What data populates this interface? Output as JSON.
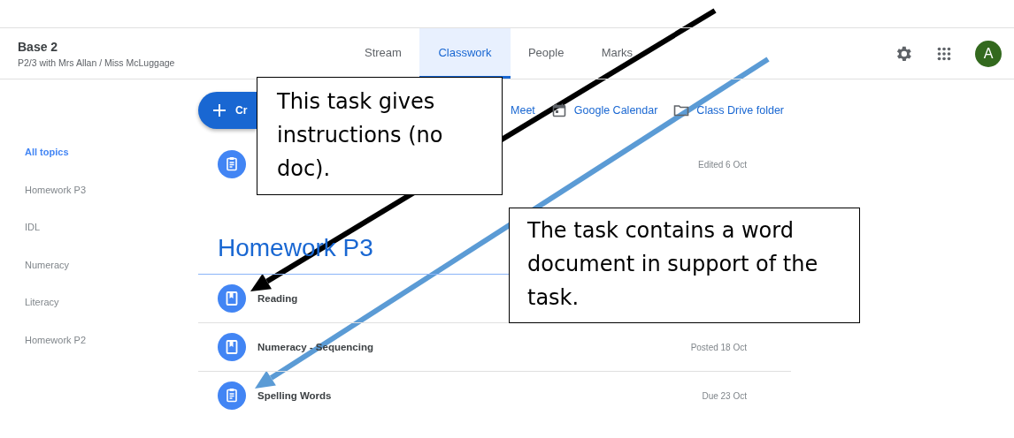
{
  "header": {
    "title": "Base 2",
    "subtitle": "P2/3 with Mrs Allan / Miss McLuggage"
  },
  "tabs": [
    {
      "label": "Stream",
      "selected": false
    },
    {
      "label": "Classwork",
      "selected": true
    },
    {
      "label": "People",
      "selected": false
    },
    {
      "label": "Marks",
      "selected": false
    }
  ],
  "avatar": {
    "initial": "A"
  },
  "create_button": {
    "label": "Cr"
  },
  "links": [
    {
      "label": "Meet"
    },
    {
      "label": "Google Calendar",
      "kind": "calendar"
    },
    {
      "label": "Class Drive folder",
      "kind": "folder"
    }
  ],
  "sidebar": {
    "items": [
      {
        "label": "All topics",
        "selected": true
      },
      {
        "label": "Homework P3",
        "selected": false
      },
      {
        "label": "IDL",
        "selected": false
      },
      {
        "label": "Numeracy",
        "selected": false
      },
      {
        "label": "Literacy",
        "selected": false
      },
      {
        "label": "Homework P2",
        "selected": false
      }
    ]
  },
  "top_items": [
    {
      "kind": "assignment",
      "date": "Edited 6 Oct"
    }
  ],
  "topics": [
    {
      "heading": "Homework P3",
      "items": [
        {
          "kind": "material",
          "title": "Reading"
        },
        {
          "kind": "material",
          "title": "Numeracy - Sequencing",
          "date": "Posted 18 Oct"
        },
        {
          "kind": "assignment",
          "title": "Spelling Words",
          "date": "Due 23 Oct"
        }
      ]
    }
  ],
  "annotations": [
    {
      "text": "This task gives instructions (no doc).",
      "color": "#000000"
    },
    {
      "text": "The task contains a word document in support of the task.",
      "color": "#5b9bd5"
    }
  ]
}
